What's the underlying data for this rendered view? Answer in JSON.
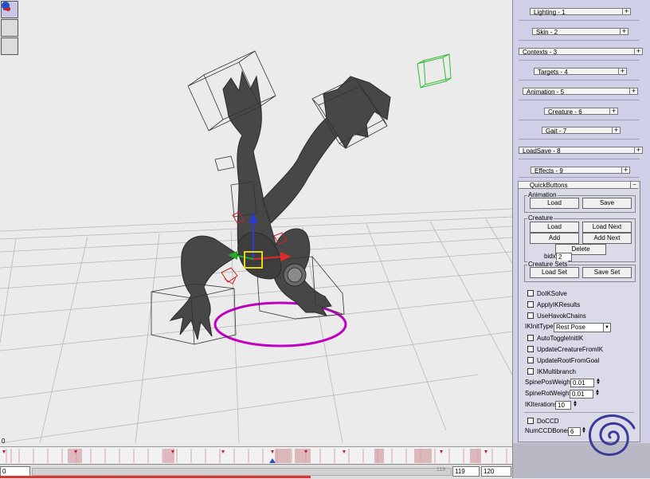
{
  "colors": {
    "panel_bg": "#cfcfe8",
    "selection": "#c000c0",
    "target_box": "#33bb33",
    "gizmo_y": "#2b3bd8",
    "gizmo_x": "#d82b2b",
    "gizmo_z": "#22aa22",
    "gizmo_center": "#e6d51a"
  },
  "toolbox": [
    {
      "icon": "cursor-arrow-icon"
    },
    {
      "icon": "paint-brush-icon"
    },
    {
      "icon": "sphere-tool-icon"
    }
  ],
  "timeline": {
    "start_label": "0",
    "start_frame": "0",
    "scrub_value": "119",
    "current_frame": "119",
    "end_frame": "120"
  },
  "rollouts": [
    {
      "label": "Lighting - 1"
    },
    {
      "label": "Skin - 2"
    },
    {
      "label": "Contexts - 3"
    },
    {
      "label": "Targets - 4"
    },
    {
      "label": "Animation - 5"
    },
    {
      "label": "Creature - 6"
    },
    {
      "label": "Gait - 7"
    },
    {
      "label": "LoadSave - 8"
    },
    {
      "label": "Effects - 9"
    }
  ],
  "rollout_plus": "+",
  "quickbuttons": {
    "title": "QuickButtons",
    "collapse": "−",
    "animation": {
      "label": "Animation",
      "load": "Load",
      "save": "Save"
    },
    "creature": {
      "label": "Creature",
      "load": "Load",
      "load_next": "Load Next",
      "add": "Add",
      "add_next": "Add Next",
      "delete": "Delete",
      "bidx_label": "bidx",
      "bidx_value": "2"
    },
    "creature_sets": {
      "label": "Creature Sets",
      "load_set": "Load Set",
      "save_set": "Save Set"
    },
    "checkboxes": [
      "DoIKSolve",
      "ApplyIKResults",
      "UseHavokChains"
    ],
    "ikinit": {
      "label": "IKInitType",
      "value": "Rest Pose"
    },
    "checkboxes2": [
      "AutoToggleInitIK",
      "UpdateCreatureFromIK",
      "UpdateRootFromGoal",
      "IKMultibranch"
    ],
    "spine_pos": {
      "label": "SpinePosWeight",
      "value": "0.01"
    },
    "spine_rot": {
      "label": "SpineRotWeight",
      "value": "0.01"
    },
    "ik_iter": {
      "label": "IKIterations",
      "value": "10"
    },
    "doccd": "DoCCD",
    "numccd": {
      "label": "NumCCDBones",
      "value": "6"
    }
  }
}
